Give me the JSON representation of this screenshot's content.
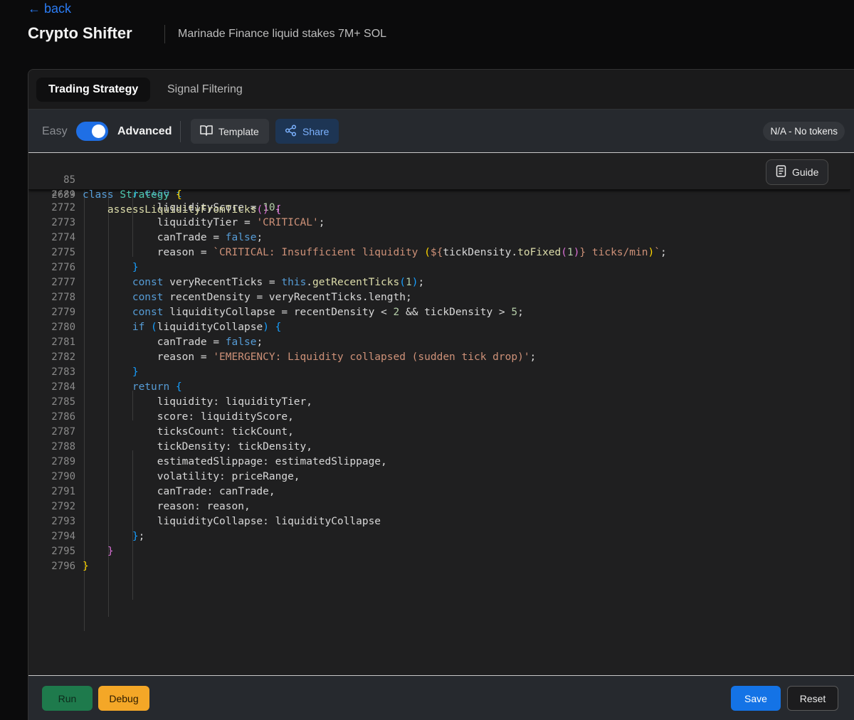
{
  "header": {
    "back_label": "← back",
    "title": "Crypto Shifter",
    "subtitle": "Marinade Finance liquid stakes 7M+ SOL"
  },
  "tabs": [
    {
      "label": "Trading Strategy",
      "active": true
    },
    {
      "label": "Signal Filtering",
      "active": false
    }
  ],
  "toolbar": {
    "mode_easy": "Easy",
    "mode_advanced": "Advanced",
    "advanced_enabled": true,
    "template_label": "Template",
    "share_label": "Share",
    "token_status": "N/A - No tokens"
  },
  "editor": {
    "guide_label": "Guide",
    "sticky_lines": [
      {
        "num": "85",
        "text": "class Strategy {"
      },
      {
        "num": "2689",
        "text": "    assessLiquidityFromTicks() {"
      }
    ],
    "partial_line": {
      "num": "2771",
      "text": "        } else {"
    },
    "lines": [
      {
        "num": "2772",
        "text": "            liquidityScore = 10;"
      },
      {
        "num": "2773",
        "text": "            liquidityTier = 'CRITICAL';"
      },
      {
        "num": "2774",
        "text": "            canTrade = false;"
      },
      {
        "num": "2775",
        "text": "            reason = `CRITICAL: Insufficient liquidity (${tickDensity.toFixed(1)} ticks/min)`;"
      },
      {
        "num": "2776",
        "text": "        }"
      },
      {
        "num": "2777",
        "text": "        const veryRecentTicks = this.getRecentTicks(1);"
      },
      {
        "num": "2778",
        "text": "        const recentDensity = veryRecentTicks.length;"
      },
      {
        "num": "2779",
        "text": "        const liquidityCollapse = recentDensity < 2 && tickDensity > 5;"
      },
      {
        "num": "2780",
        "text": "        if (liquidityCollapse) {"
      },
      {
        "num": "2781",
        "text": "            canTrade = false;"
      },
      {
        "num": "2782",
        "text": "            reason = 'EMERGENCY: Liquidity collapsed (sudden tick drop)';"
      },
      {
        "num": "2783",
        "text": "        }"
      },
      {
        "num": "2784",
        "text": "        return {"
      },
      {
        "num": "2785",
        "text": "            liquidity: liquidityTier,"
      },
      {
        "num": "2786",
        "text": "            score: liquidityScore,"
      },
      {
        "num": "2787",
        "text": "            ticksCount: tickCount,"
      },
      {
        "num": "2788",
        "text": "            tickDensity: tickDensity,"
      },
      {
        "num": "2789",
        "text": "            estimatedSlippage: estimatedSlippage,"
      },
      {
        "num": "2790",
        "text": "            volatility: priceRange,"
      },
      {
        "num": "2791",
        "text": "            canTrade: canTrade,"
      },
      {
        "num": "2792",
        "text": "            reason: reason,"
      },
      {
        "num": "2793",
        "text": "            liquidityCollapse: liquidityCollapse"
      },
      {
        "num": "2794",
        "text": "        };"
      },
      {
        "num": "2795",
        "text": "    }"
      },
      {
        "num": "2796",
        "text": "}"
      }
    ]
  },
  "footer": {
    "run_label": "Run",
    "debug_label": "Debug",
    "save_label": "Save",
    "reset_label": "Reset"
  },
  "colors": {
    "accent": "#1473e6",
    "run": "#1e7a4c",
    "debug": "#f4a727",
    "link": "#2b7cf4"
  }
}
